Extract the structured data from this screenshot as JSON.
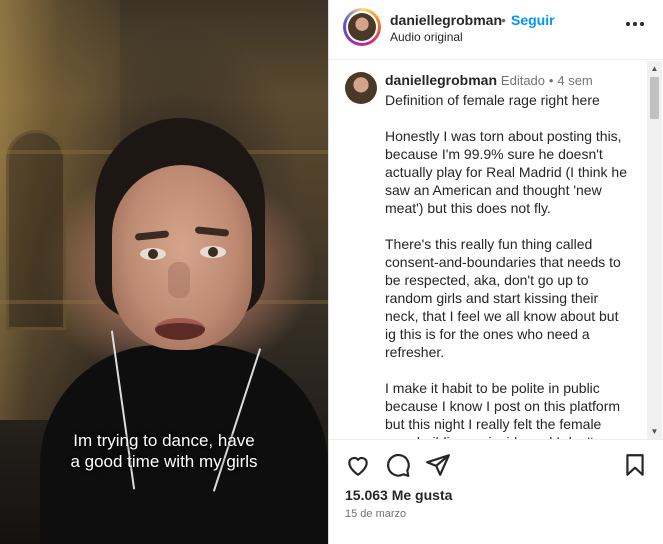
{
  "video": {
    "caption_line1": "Im trying to dance, have",
    "caption_line2": "a good time with my girls"
  },
  "header": {
    "username": "daniellegrobman",
    "separator": "•",
    "follow_label": "Seguir",
    "audio_label": "Audio original",
    "more_icon": "more-options-icon"
  },
  "comment": {
    "username": "daniellegrobman",
    "edited_label": "Editado",
    "separator": "•",
    "time": "4 sem",
    "paragraphs": [
      [
        "Definition of female rage right here"
      ],
      [
        "Honestly I was torn about posting this,",
        "because I'm 99.9% sure he doesn't",
        "actually play for Real Madrid (I think he",
        "saw an American and thought 'new",
        "meat') but this does not fly."
      ],
      [
        "There's this really fun thing called",
        "consent-and-boundaries that needs to",
        "be respected, aka, don't go up to",
        "random girls and start kissing their",
        "neck, that I feel we all know about but",
        "ig this is for the ones who need a",
        "refresher."
      ],
      [
        "I make it habit to be polite in public",
        "because I know I post on this platform",
        "but this night I really felt the female",
        "rage building up inside and I don't"
      ]
    ]
  },
  "actions": {
    "like_icon": "heart-icon",
    "comment_icon": "comment-icon",
    "share_icon": "send-icon",
    "save_icon": "bookmark-icon",
    "likes_text": "15.063 Me gusta",
    "date_text": "15 de marzo"
  },
  "colors": {
    "follow": "#0095f6",
    "text": "#262626",
    "muted": "#737373"
  }
}
